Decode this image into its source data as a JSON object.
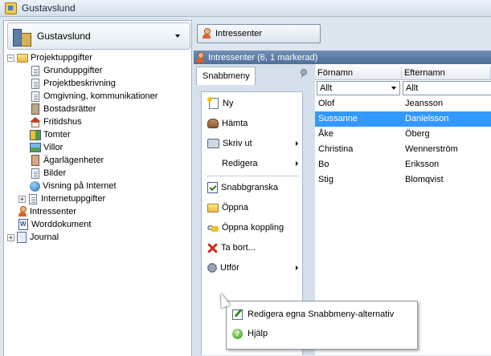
{
  "window": {
    "title": "Gustavslund"
  },
  "left": {
    "db_name": "Gustavslund",
    "tree": {
      "projektuppgifter": "Projektuppgifter",
      "children": [
        "Grunduppgifter",
        "Projektbeskrivning",
        "Omgivning, kommunikationer",
        "Bostadsrätter",
        "Fritidshus",
        "Tomter",
        "Villor",
        "Ägarlägenheter",
        "Bilder",
        "Visning på Internet",
        "Internetuppgifter"
      ],
      "intressenter": "Intressenter",
      "worddokument": "Worddokument",
      "journal": "Journal"
    }
  },
  "right": {
    "category_button": "Intressenter",
    "header": "Intressenter (6, 1 markerad)",
    "quick_tab": "Snabbmeny",
    "menu": {
      "ny": "Ny",
      "hamta": "Hämta",
      "skriv_ut": "Skriv ut",
      "redigera": "Redigera",
      "snabbgranska": "Snabbgranska",
      "oppna": "Öppna",
      "oppna_koppling": "Öppna koppling",
      "ta_bort": "Ta bort...",
      "utfor": "Utför"
    },
    "grid": {
      "columns": [
        "Förnamn",
        "Efternamn"
      ],
      "filters": [
        "Allt",
        "Allt"
      ],
      "rows": [
        [
          "Olof",
          "Jeansson"
        ],
        [
          "Sussanne",
          "Danielsson"
        ],
        [
          "Åke",
          "Öberg"
        ],
        [
          "Christina",
          "Wennerström"
        ],
        [
          "Bo",
          "Eriksson"
        ],
        [
          "Stig",
          "Blomqvist"
        ]
      ],
      "selected_row": 1
    }
  },
  "context_menu": {
    "edit": "Redigera egna Snabbmeny-alternativ",
    "help": "Hjälp"
  }
}
